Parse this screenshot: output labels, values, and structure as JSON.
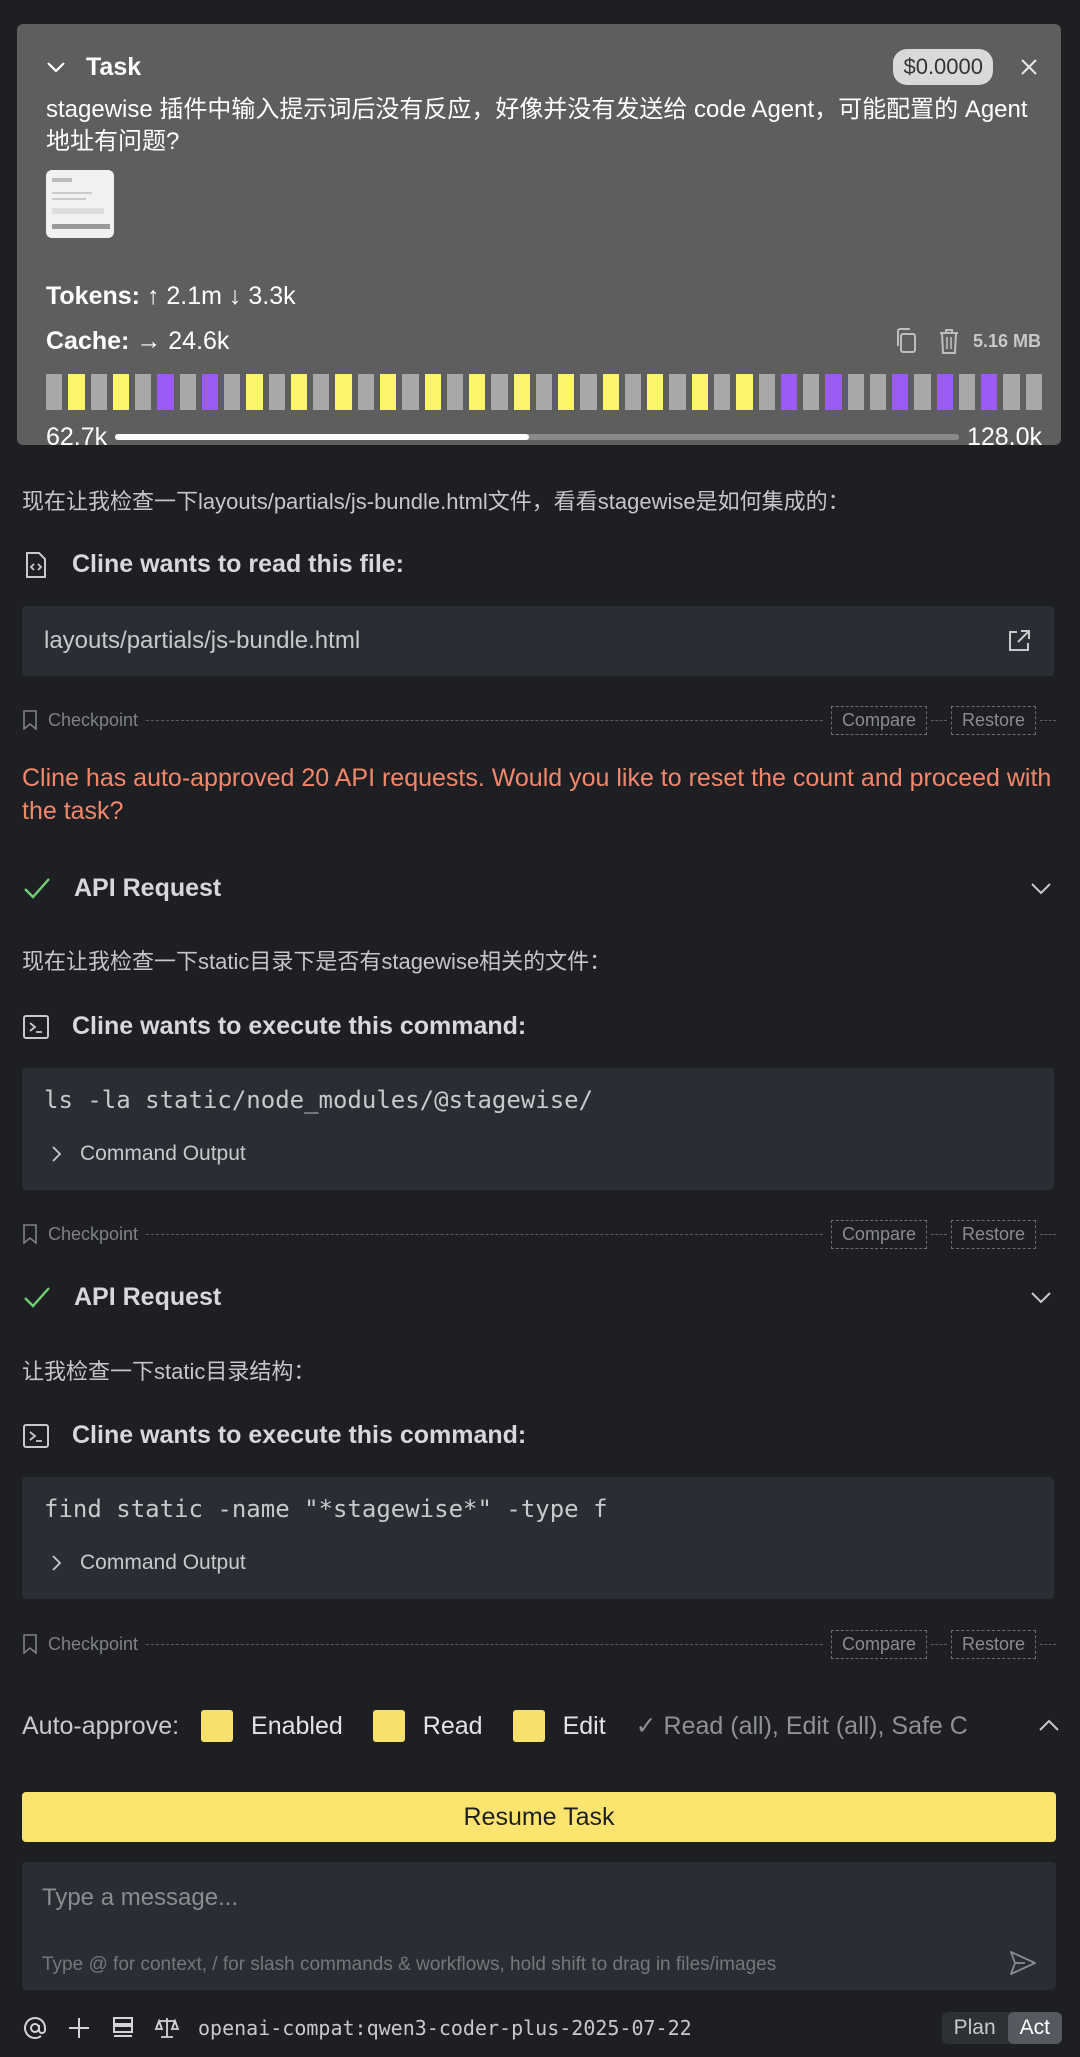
{
  "task": {
    "title": "Task",
    "cost": "$0.0000",
    "text": "stagewise 插件中输入提示词后没有反应，好像并没有发送给 code Agent，可能配置的 Agent 地址有问题?",
    "tokens_label": "Tokens:",
    "tokens_value": "↑ 2.1m ↓ 3.3k",
    "cache_label": "Cache:",
    "cache_value": "→ 24.6k",
    "size": "5.16 MB",
    "context_used": "62.7k",
    "context_max": "128.0k",
    "context_fraction": 0.49,
    "context_blocks": [
      "gray",
      "yellow",
      "gray",
      "yellow",
      "gray",
      "purple",
      "gray",
      "purple",
      "gray",
      "yellow",
      "gray",
      "yellow",
      "gray",
      "yellow",
      "gray",
      "yellow",
      "gray",
      "yellow",
      "gray",
      "yellow",
      "gray",
      "yellow",
      "gray",
      "yellow",
      "gray",
      "yellow",
      "gray",
      "yellow",
      "gray",
      "yellow",
      "gray",
      "yellow",
      "gray",
      "purple",
      "gray",
      "purple",
      "gray",
      "gray",
      "purple",
      "gray",
      "purple",
      "gray",
      "purple",
      "gray",
      "gray"
    ],
    "colors": {
      "yellow": "#faf56a",
      "purple": "#9b5cf5",
      "gray": "#a8a8a8"
    }
  },
  "messages": {
    "msg1": "现在让我检查一下layouts/partials/js-bundle.html文件，看看stagewise是如何集成的：",
    "read_file_heading": "Cline wants to read this file:",
    "read_file_path": "layouts/partials/js-bundle.html",
    "warning": "Cline has auto-approved 20 API requests. Would you like to reset the count and proceed with the task?",
    "api_request_label": "API Request",
    "msg2": "现在让我检查一下static目录下是否有stagewise相关的文件：",
    "exec_heading": "Cline wants to execute this command:",
    "cmd1": "ls -la static/node_modules/@stagewise/",
    "command_output": "Command Output",
    "msg3": "让我检查一下static目录结构：",
    "cmd2": "find static -name \"*stagewise*\" -type f"
  },
  "checkpoint": {
    "label": "Checkpoint",
    "compare": "Compare",
    "restore": "Restore"
  },
  "auto_approve": {
    "label": "Auto-approve:",
    "enabled": "Enabled",
    "read": "Read",
    "edit": "Edit",
    "summary": "✓ Read (all), Edit (all), Safe C"
  },
  "resume_button": "Resume Task",
  "input": {
    "placeholder": "Type a message...",
    "hint": "Type @ for context, / for slash commands & workflows, hold shift to drag in files/images"
  },
  "bottom": {
    "model": "openai-compat:qwen3-coder-plus-2025-07-22",
    "plan": "Plan",
    "act": "Act"
  }
}
